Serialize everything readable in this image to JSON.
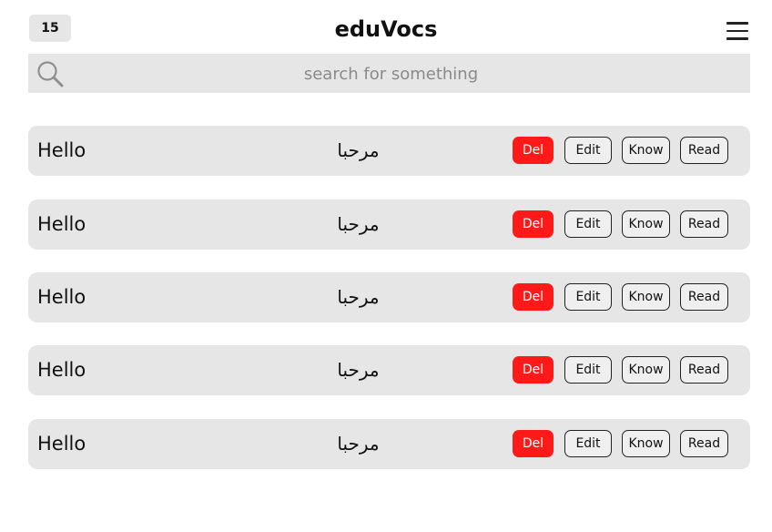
{
  "header": {
    "count": "15",
    "title": "eduVocs",
    "menu_icon": "hamburger-menu-icon"
  },
  "search": {
    "icon": "search-icon",
    "placeholder": "search for something",
    "value": ""
  },
  "vocab_list": [
    {
      "word": "Hello",
      "translation": "مرحبا",
      "del_label": "Del",
      "edit_label": "Edit",
      "know_label": "Know",
      "read_label": "Read"
    },
    {
      "word": "Hello",
      "translation": "مرحبا",
      "del_label": "Del",
      "edit_label": "Edit",
      "know_label": "Know",
      "read_label": "Read"
    },
    {
      "word": "Hello",
      "translation": "مرحبا",
      "del_label": "Del",
      "edit_label": "Edit",
      "know_label": "Know",
      "read_label": "Read"
    },
    {
      "word": "Hello",
      "translation": "مرحبا",
      "del_label": "Del",
      "edit_label": "Edit",
      "know_label": "Know",
      "read_label": "Read"
    },
    {
      "word": "Hello",
      "translation": "مرحبا",
      "del_label": "Del",
      "edit_label": "Edit",
      "know_label": "Know",
      "read_label": "Read"
    }
  ],
  "colors": {
    "background": "#ffffff",
    "panel": "#e6e6e6",
    "delete_button": "#ff1a1a",
    "text": "#111111"
  }
}
